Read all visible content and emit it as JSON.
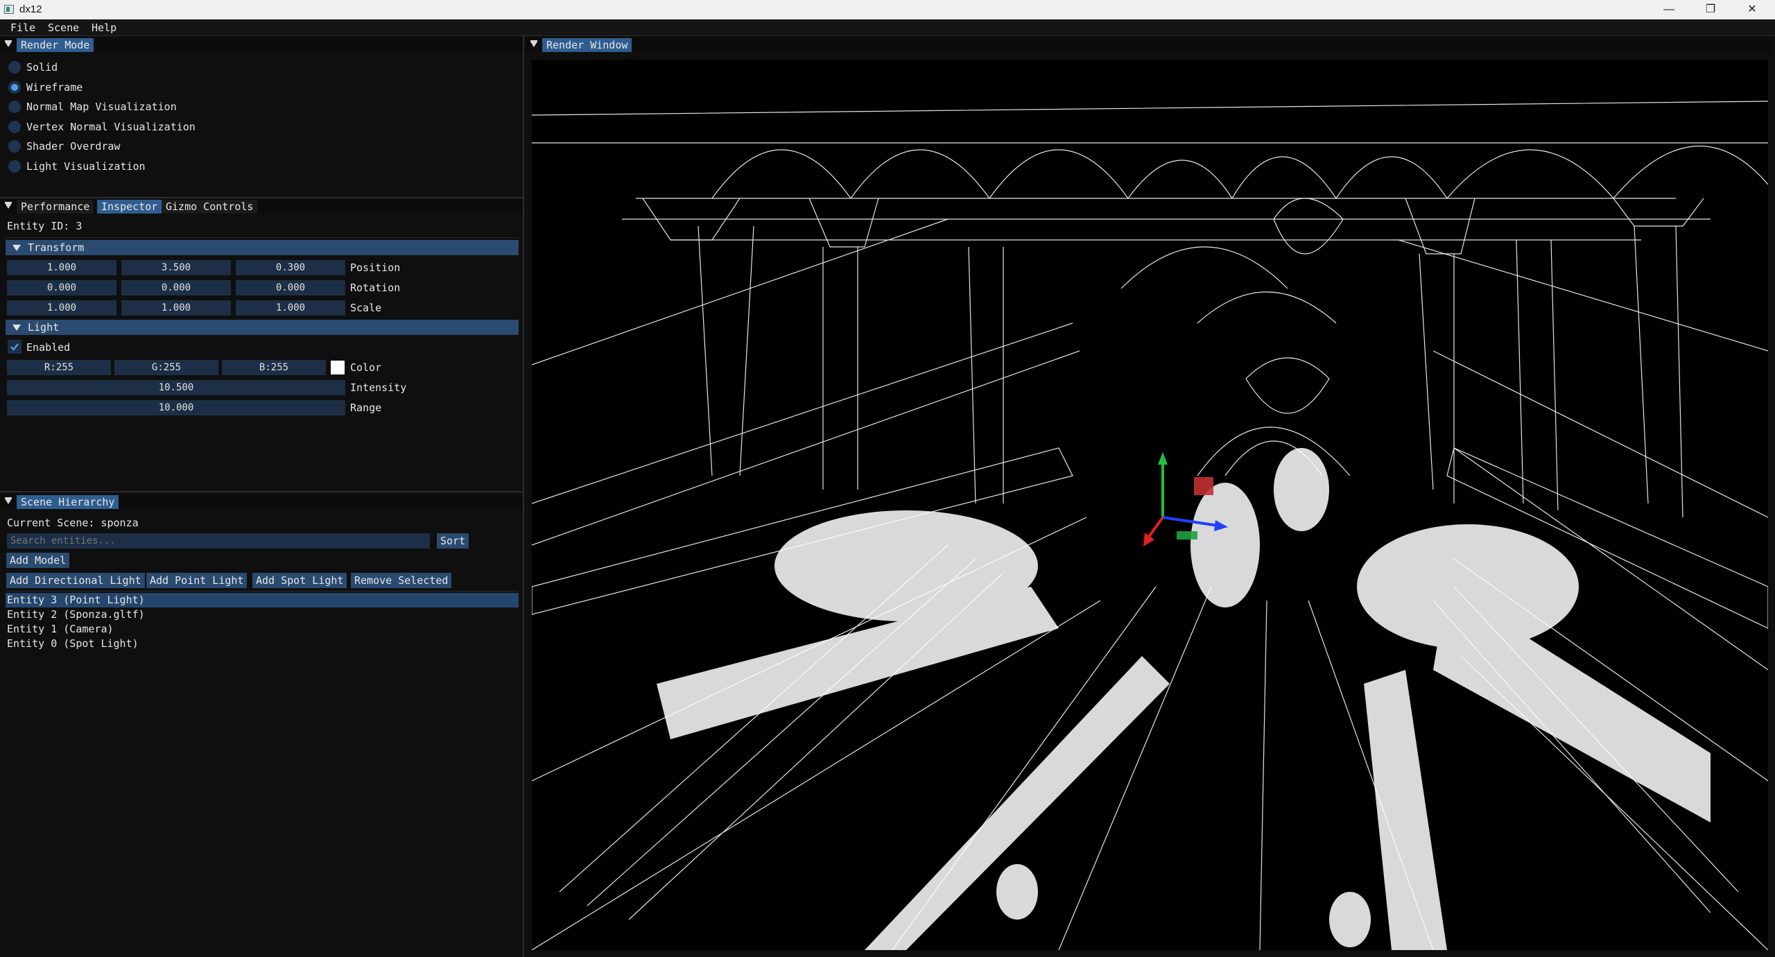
{
  "window": {
    "title": "dx12",
    "controls": [
      "—",
      "❐",
      "✕"
    ]
  },
  "menu": [
    "File",
    "Scene",
    "Help"
  ],
  "render_mode_panel": {
    "tab": "Render Mode",
    "options": [
      "Solid",
      "Wireframe",
      "Normal Map Visualization",
      "Vertex Normal Visualization",
      "Shader Overdraw",
      "Light Visualization"
    ],
    "selected": "Wireframe"
  },
  "tabs": {
    "performance": "Performance",
    "inspector": "Inspector",
    "gizmo": "Gizmo Controls",
    "active": "Inspector"
  },
  "inspector": {
    "entity_id": "Entity ID: 3",
    "transform": {
      "header": "Transform",
      "rows": [
        {
          "values": [
            "1.000",
            "3.500",
            "0.300"
          ],
          "label": "Position"
        },
        {
          "values": [
            "0.000",
            "0.000",
            "0.000"
          ],
          "label": "Rotation"
        },
        {
          "values": [
            "1.000",
            "1.000",
            "1.000"
          ],
          "label": "Scale"
        }
      ]
    },
    "light": {
      "header": "Light",
      "enabled_label": "Enabled",
      "enabled": true,
      "color": {
        "r": "R:255",
        "g": "G:255",
        "b": "B:255",
        "label": "Color",
        "swatch": "#ffffff"
      },
      "intensity": {
        "value": "10.500",
        "label": "Intensity"
      },
      "range": {
        "value": "10.000",
        "label": "Range"
      }
    }
  },
  "hierarchy": {
    "tab": "Scene Hierarchy",
    "current_scene": "Current Scene: sponza",
    "search_placeholder": "Search entities...",
    "sort_label": "Sort",
    "add_model": "Add Model",
    "buttons": [
      "Add Directional Light",
      "Add Point Light",
      "Add Spot Light",
      "Remove Selected"
    ],
    "entities": [
      "Entity 3 (Point Light)",
      "Entity 2 (Sponza.gltf)",
      "Entity 1 (Camera)",
      "Entity 0 (Spot Light)"
    ],
    "selected_index": 0
  },
  "render_window": {
    "tab": "Render Window"
  },
  "colors": {
    "accent": "#2f5d8f",
    "section": "#2a4a70",
    "field": "#1c2f46",
    "gizmo_x": "#2040ff",
    "gizmo_y": "#20c040",
    "gizmo_z": "#e02020"
  }
}
